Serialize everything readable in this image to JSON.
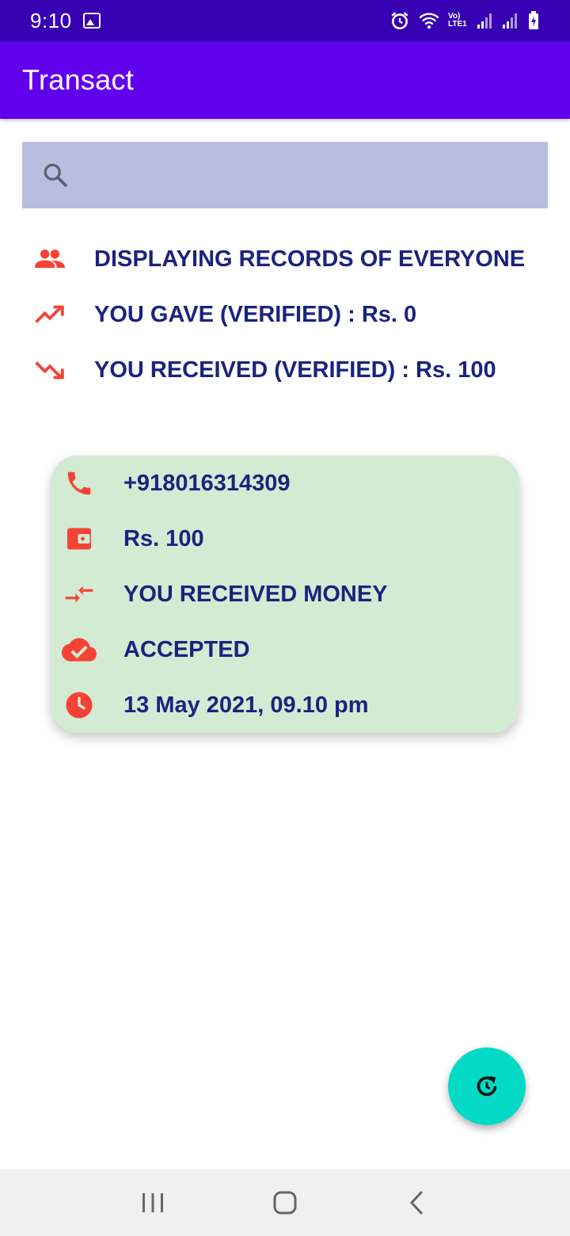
{
  "status_bar": {
    "time": "9:10",
    "network_label": "Vo) LTE1"
  },
  "app_bar": {
    "title": "Transact"
  },
  "search": {
    "placeholder": "",
    "value": ""
  },
  "summary": {
    "scope_text": "DISPLAYING RECORDS OF EVERYONE",
    "gave_text": "YOU GAVE (VERIFIED) : Rs. 0",
    "received_text": "YOU RECEIVED (VERIFIED) : Rs. 100"
  },
  "transaction": {
    "phone": "+918016314309",
    "amount": "Rs. 100",
    "direction": "YOU RECEIVED MONEY",
    "status": "ACCEPTED",
    "datetime": "13 May 2021, 09.10 pm"
  },
  "icons": {
    "people": "people-icon",
    "trending_up": "trending-up-icon",
    "trending_down": "trending-down-icon",
    "phone": "phone-icon",
    "wallet": "wallet-icon",
    "compare_arrows": "compare-arrows-icon",
    "cloud_done": "cloud-done-icon",
    "clock": "clock-icon",
    "refresh": "refresh-icon"
  },
  "colors": {
    "status_bar": "#3700b3",
    "app_bar": "#6200ee",
    "search_bg": "#b9bde0",
    "accent_red": "#f44336",
    "text_navy": "#1a237e",
    "card_bg": "#d3ebd3",
    "fab": "#03dac5"
  }
}
